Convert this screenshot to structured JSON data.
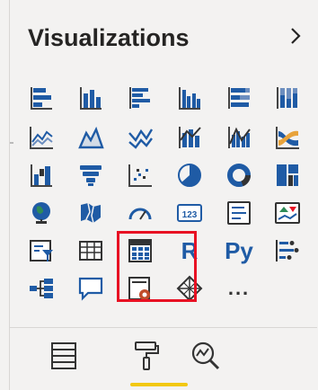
{
  "pane": {
    "title": "Visualizations",
    "chevron_icon": "chevron-right-icon"
  },
  "visuals": [
    {
      "name": "stacked-bar-chart-icon"
    },
    {
      "name": "stacked-column-chart-icon"
    },
    {
      "name": "clustered-bar-chart-icon"
    },
    {
      "name": "clustered-column-chart-icon"
    },
    {
      "name": "100-stacked-bar-chart-icon"
    },
    {
      "name": "100-stacked-column-chart-icon"
    },
    {
      "name": "line-chart-icon"
    },
    {
      "name": "area-chart-icon"
    },
    {
      "name": "stacked-area-chart-icon"
    },
    {
      "name": "line-and-stacked-column-icon"
    },
    {
      "name": "line-and-clustered-column-icon"
    },
    {
      "name": "ribbon-chart-icon"
    },
    {
      "name": "waterfall-chart-icon"
    },
    {
      "name": "funnel-icon"
    },
    {
      "name": "scatter-chart-icon"
    },
    {
      "name": "pie-chart-icon"
    },
    {
      "name": "donut-chart-icon"
    },
    {
      "name": "treemap-icon"
    },
    {
      "name": "map-icon"
    },
    {
      "name": "filled-map-icon"
    },
    {
      "name": "gauge-icon"
    },
    {
      "name": "card-icon",
      "text": "123"
    },
    {
      "name": "multi-row-card-icon"
    },
    {
      "name": "kpi-icon"
    },
    {
      "name": "slicer-icon"
    },
    {
      "name": "table-icon"
    },
    {
      "name": "matrix-icon"
    },
    {
      "name": "r-script-visual-icon",
      "text": "R"
    },
    {
      "name": "python-visual-icon",
      "text": "Py"
    },
    {
      "name": "key-influencers-icon"
    },
    {
      "name": "decomposition-tree-icon"
    },
    {
      "name": "qa-icon"
    },
    {
      "name": "paginated-report-icon"
    },
    {
      "name": "power-apps-icon"
    },
    {
      "name": "more-visuals-icon",
      "text": "..."
    }
  ],
  "bottom_tabs": [
    {
      "name": "fields-tab-icon"
    },
    {
      "name": "format-tab-icon"
    },
    {
      "name": "analytics-tab-icon"
    }
  ],
  "colors": {
    "blue": "#1f5ba5",
    "dark": "#252423",
    "highlight": "#e81123",
    "accent": "#f2c811"
  }
}
